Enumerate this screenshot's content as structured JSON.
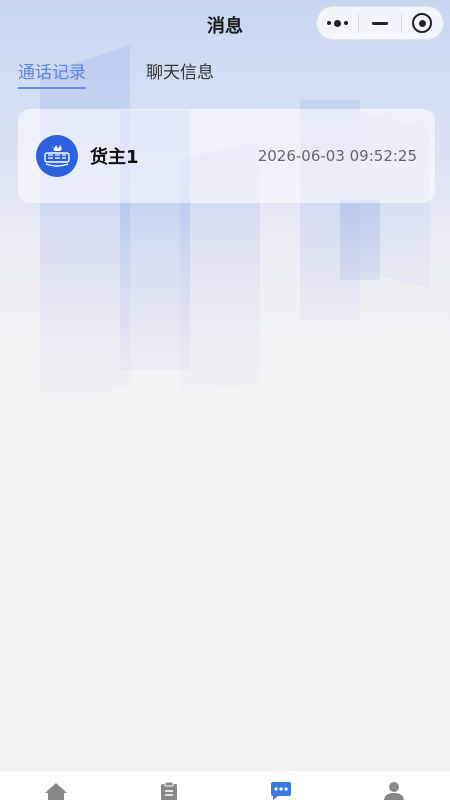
{
  "navbar": {
    "title": "消息"
  },
  "tabs": [
    {
      "label": "通话记录",
      "active": true
    },
    {
      "label": "聊天信息",
      "active": false
    }
  ],
  "records": [
    {
      "name": "货主1",
      "time": "2026-06-03 09:52:25",
      "avatar_icon": "logo-avatar-icon"
    }
  ],
  "tabbar": {
    "items": [
      {
        "icon": "home-icon",
        "active": false
      },
      {
        "icon": "clipboard-icon",
        "active": false
      },
      {
        "icon": "chat-bubble-icon",
        "active": true
      },
      {
        "icon": "user-icon",
        "active": false
      }
    ],
    "active_color": "#3a7be0",
    "inactive_color": "#888888"
  },
  "colors": {
    "accent": "#5d86e0",
    "avatar_bg": "#2c62df"
  }
}
